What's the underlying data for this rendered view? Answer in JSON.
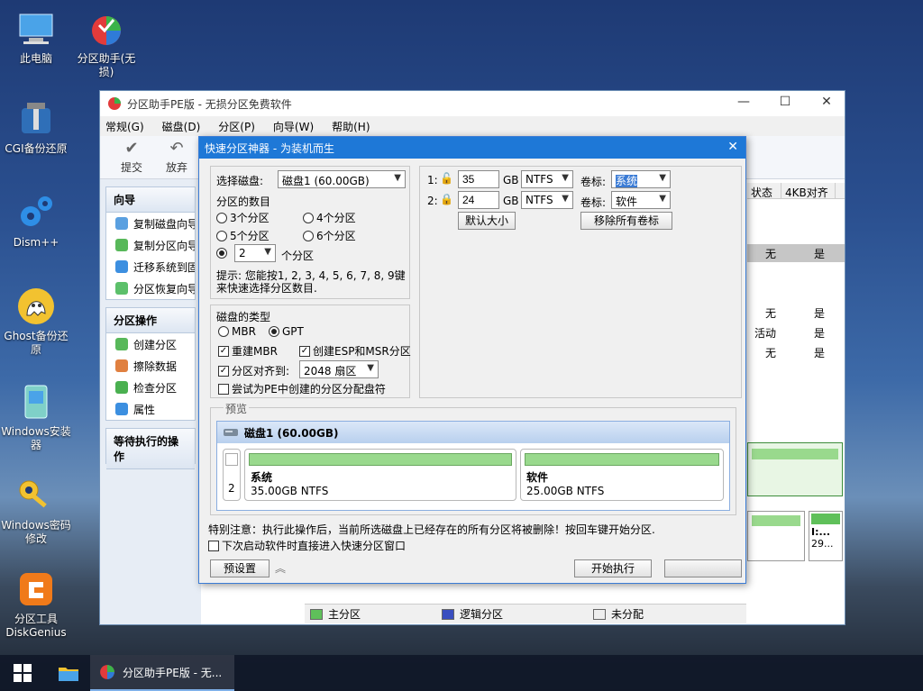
{
  "desktop": {
    "icons": [
      {
        "label": "此电脑"
      },
      {
        "label": "分区助手(无损)"
      },
      {
        "label": "CGI备份还原"
      },
      {
        "label": "Dism++"
      },
      {
        "label": "Ghost备份还原"
      },
      {
        "label": "Windows安装器"
      },
      {
        "label": "Windows密码修改"
      },
      {
        "label": "分区工具DiskGenius"
      }
    ]
  },
  "mainwindow": {
    "title": "分区助手PE版 - 无损分区免费软件",
    "controls": {
      "min": "—",
      "max": "☐",
      "close": "✕"
    },
    "menu": [
      "常规(G)",
      "磁盘(D)",
      "分区(P)",
      "向导(W)",
      "帮助(H)"
    ],
    "toolbar": {
      "submit": "提交",
      "discard": "放弃"
    },
    "left": {
      "wizard": {
        "title": "向导",
        "items": [
          "复制磁盘向导",
          "复制分区向导",
          "迁移系统到固",
          "分区恢复向导"
        ]
      },
      "ops": {
        "title": "分区操作",
        "items": [
          "创建分区",
          "擦除数据",
          "检查分区",
          "属性"
        ]
      },
      "pending": {
        "title": "等待执行的操作"
      }
    },
    "table": {
      "headers": [
        "状态",
        "4KB对齐"
      ],
      "rows": [
        [
          "无",
          "是"
        ],
        [
          "无",
          "是"
        ],
        [
          "活动",
          "是"
        ],
        [
          "无",
          "是"
        ]
      ]
    },
    "mini_disk_label": {
      "line1": "I:...",
      "line2": "29..."
    },
    "statusbar": {
      "primary": "主分区",
      "logical": "逻辑分区",
      "unalloc": "未分配"
    }
  },
  "dialog": {
    "title": "快速分区神器 - 为装机而生",
    "close": "✕",
    "select_disk_label": "选择磁盘:",
    "disk_value": "磁盘1 (60.00GB)",
    "count_label": "分区的数目",
    "counts": {
      "c3": "3个分区",
      "c4": "4个分区",
      "c5": "5个分区",
      "c6": "6个分区"
    },
    "custom_count": "2",
    "custom_suffix": "个分区",
    "hint": "提示: 您能按1, 2, 3, 4, 5, 6, 7, 8, 9键来快速选择分区数目.",
    "disk_type_label": "磁盘的类型",
    "mbr": "MBR",
    "gpt": "GPT",
    "rebuild_mbr": "重建MBR",
    "create_esp": "创建ESP和MSR分区",
    "align_label": "分区对齐到:",
    "align_value": "2048 扇区",
    "try_letter": "尝试为PE中创建的分区分配盘符",
    "partitions": [
      {
        "index": "1:",
        "size": "35",
        "unit": "GB",
        "fs": "NTFS",
        "label_title": "卷标:",
        "label": "系统"
      },
      {
        "index": "2:",
        "size": "24",
        "unit": "GB",
        "fs": "NTFS",
        "label_title": "卷标:",
        "label": "软件"
      }
    ],
    "default_size_btn": "默认大小",
    "remove_labels_btn": "移除所有卷标",
    "preview_label": "预览",
    "preview": {
      "disk_title": "磁盘1 (60.00GB)",
      "count": "2",
      "parts": [
        {
          "name": "系统",
          "detail": "35.00GB NTFS"
        },
        {
          "name": "软件",
          "detail": "25.00GB NTFS"
        }
      ]
    },
    "warning": "特别注意：执行此操作后，当前所选磁盘上已经存在的所有分区将被删除！按回车键开始分区.",
    "startup_check": "下次启动软件时直接进入快速分区窗口",
    "preset_btn": "预设置",
    "start_btn": "开始执行"
  },
  "taskbar": {
    "app_label": "分区助手PE版 - 无..."
  }
}
